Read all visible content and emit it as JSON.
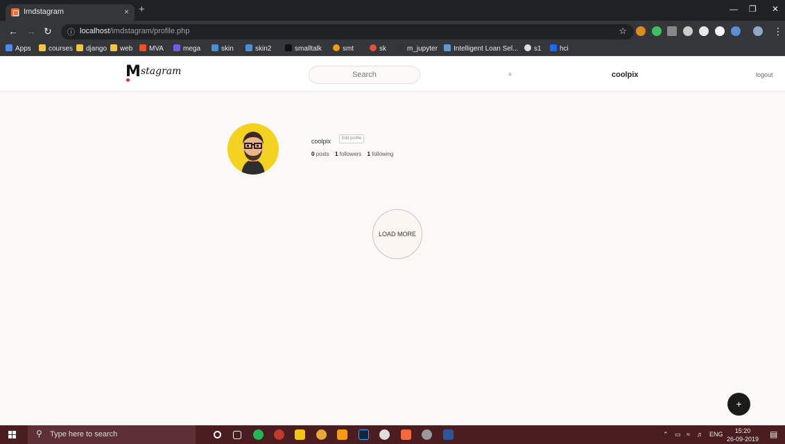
{
  "browser": {
    "tab_title": "Imdstagram",
    "tab_close": "×",
    "new_tab": "+",
    "url_host": "localhost",
    "url_path": "/imdstagram/profile.php",
    "bookmarks": [
      "Apps",
      "courses",
      "django",
      "web",
      "MVA",
      "mega",
      "skin",
      "skin2",
      "smalltalk",
      "smt",
      "sk",
      "m_jupyter",
      "Intelligent Loan Sel...",
      "s1",
      "hci"
    ]
  },
  "header": {
    "logo_text": "stagram",
    "search_placeholder": "Search",
    "username": "coolpix",
    "logout": "logout"
  },
  "profile": {
    "name": "coolpix",
    "edit_label": "Edit profile",
    "posts_count": "0",
    "posts_label": "posts",
    "followers_count": "1",
    "followers_label": "followers",
    "following_count": "1",
    "following_label": "following"
  },
  "feed": {
    "load_more": "LOAD MORE",
    "fab": "+"
  },
  "taskbar": {
    "search_placeholder": "Type here to search",
    "lang": "ENG",
    "time": "15:20",
    "date": "26-09-2019"
  }
}
